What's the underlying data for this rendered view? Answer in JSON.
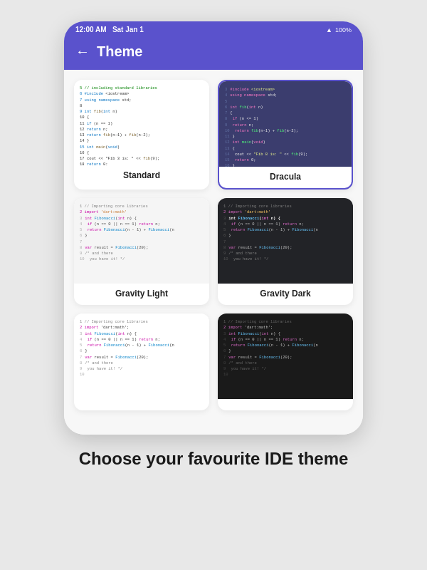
{
  "status_bar": {
    "time": "12:00 AM",
    "date": "Sat Jan 1",
    "signal": "WiFi",
    "battery": "100%"
  },
  "header": {
    "back_label": "←",
    "title": "Theme"
  },
  "themes": [
    {
      "id": "standard",
      "label": "Standard",
      "selected": false,
      "preview_type": "standard"
    },
    {
      "id": "dracula",
      "label": "Dracula",
      "selected": true,
      "preview_type": "dracula"
    },
    {
      "id": "gravity-light",
      "label": "Gravity Light",
      "selected": false,
      "preview_type": "gravity-light"
    },
    {
      "id": "gravity-dark",
      "label": "Gravity Dark",
      "selected": false,
      "preview_type": "gravity-dark"
    },
    {
      "id": "theme5",
      "label": "",
      "selected": false,
      "preview_type": "theme5"
    },
    {
      "id": "theme6",
      "label": "",
      "selected": false,
      "preview_type": "theme6"
    }
  ],
  "bottom_text": "Choose your favourite IDE theme"
}
